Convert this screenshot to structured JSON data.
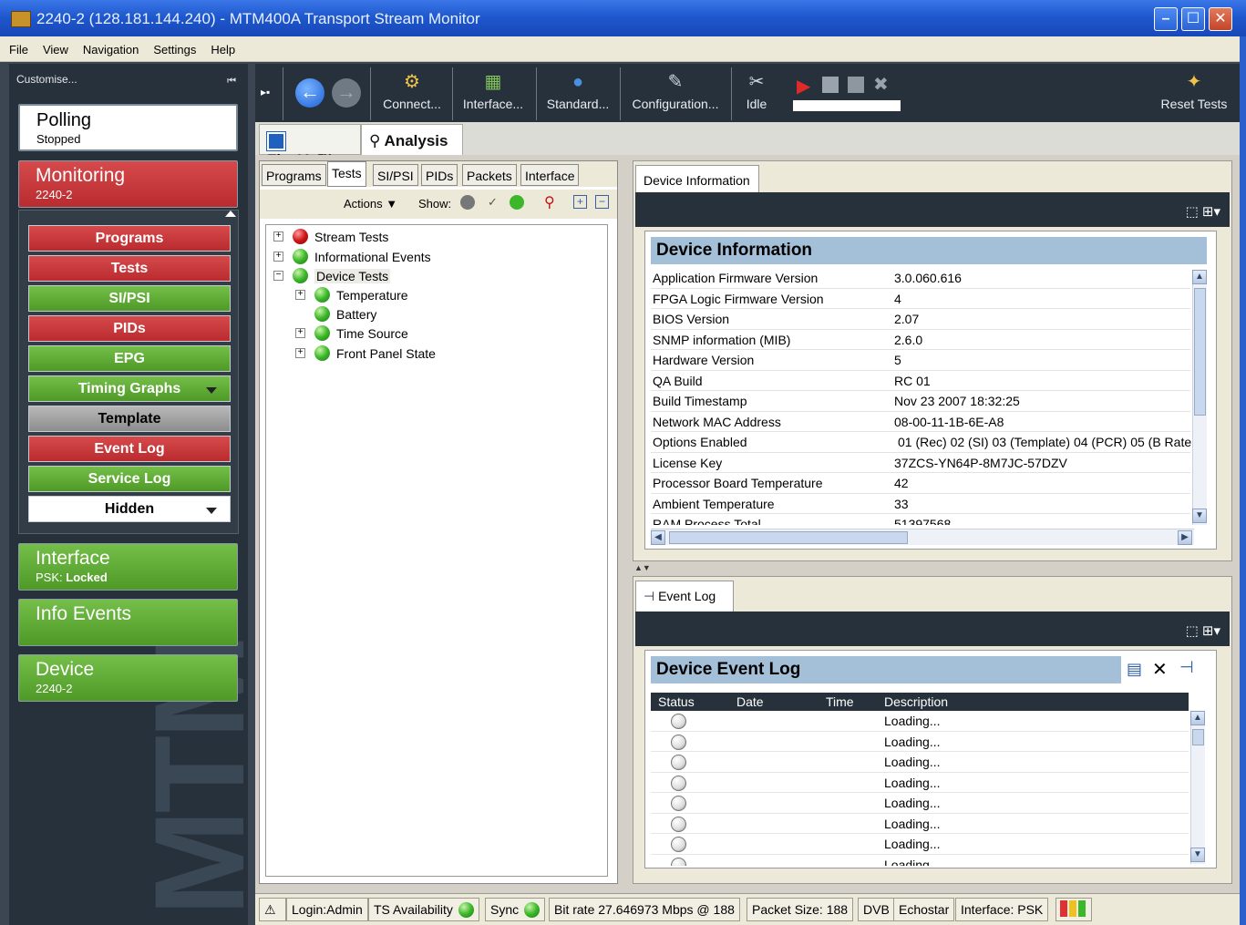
{
  "window": {
    "title": "2240-2 (128.181.144.240) - MTM400A Transport Stream Monitor"
  },
  "menu": [
    "File",
    "View",
    "Navigation",
    "Settings",
    "Help"
  ],
  "sidebar": {
    "customise_label": "Customise...",
    "polling": {
      "title": "Polling",
      "status": "Stopped"
    },
    "monitoring": {
      "title": "Monitoring",
      "sub": "2240-2"
    },
    "items": [
      {
        "label": "Programs",
        "color": "red"
      },
      {
        "label": "Tests",
        "color": "red"
      },
      {
        "label": "SI/PSI",
        "color": "green"
      },
      {
        "label": "PIDs",
        "color": "red"
      },
      {
        "label": "EPG",
        "color": "green"
      },
      {
        "label": "Timing Graphs",
        "color": "green"
      },
      {
        "label": "Template",
        "color": "gray"
      },
      {
        "label": "Event Log",
        "color": "red"
      },
      {
        "label": "Service Log",
        "color": "green"
      },
      {
        "label": "Hidden",
        "color": "white"
      }
    ],
    "interface": {
      "title": "Interface",
      "sub_prefix": "PSK: ",
      "sub_value": "Locked"
    },
    "info_events": {
      "title": "Info Events"
    },
    "device": {
      "title": "Device",
      "sub": "2240-2"
    },
    "watermark": "MTM"
  },
  "toolbar": {
    "connect": "Connect...",
    "interface": "Interface...",
    "standard": "Standard...",
    "configuration": "Configuration...",
    "idle": "Idle",
    "reset_tests": "Reset Tests"
  },
  "view_tabs": {
    "flexvu": "FlexVu™",
    "analysis": "Analysis"
  },
  "left_panel": {
    "tabs": [
      "Programs",
      "Tests",
      "SI/PSI",
      "PIDs",
      "Packets",
      "Interface"
    ],
    "actions_label": "Actions",
    "show_label": "Show:",
    "tree": [
      {
        "label": "Stream Tests",
        "status": "red",
        "level": 0,
        "expander": "+"
      },
      {
        "label": "Informational Events",
        "status": "green",
        "level": 0,
        "expander": "+"
      },
      {
        "label": "Device Tests",
        "status": "green",
        "level": 0,
        "expander": "-"
      },
      {
        "label": "Temperature",
        "status": "green",
        "level": 1,
        "expander": "+"
      },
      {
        "label": "Battery",
        "status": "green",
        "level": 1,
        "expander": ""
      },
      {
        "label": "Time Source",
        "status": "green",
        "level": 1,
        "expander": "+"
      },
      {
        "label": "Front Panel State",
        "status": "green",
        "level": 1,
        "expander": "+"
      }
    ]
  },
  "device_info": {
    "tab_label": "Device Information",
    "heading": "Device Information",
    "rows": [
      {
        "key": "Application Firmware Version",
        "value": "3.0.060.616"
      },
      {
        "key": "FPGA Logic Firmware Version",
        "value": "4"
      },
      {
        "key": "BIOS Version",
        "value": "2.07"
      },
      {
        "key": "SNMP information (MIB)",
        "value": "2.6.0"
      },
      {
        "key": "Hardware Version",
        "value": "5"
      },
      {
        "key": "QA Build",
        "value": "RC 01"
      },
      {
        "key": "Build Timestamp",
        "value": "Nov 23 2007 18:32:25"
      },
      {
        "key": "Network MAC Address",
        "value": "08-00-11-1B-6E-A8"
      },
      {
        "key": "Options Enabled",
        "value": "01 (Rec) 02 (SI) 03 (Template) 04 (PCR) 05 (B Rate"
      },
      {
        "key": "License Key",
        "value": "37ZCS-YN64P-8M7JC-57DZV"
      },
      {
        "key": "Processor Board Temperature",
        "value": "42"
      },
      {
        "key": "Ambient Temperature",
        "value": "33"
      },
      {
        "key": "RAM Process Total",
        "value": "51397568"
      }
    ]
  },
  "event_log": {
    "tab_label": "Event Log",
    "heading": "Device Event Log",
    "columns": [
      "Status",
      "Date",
      "Time",
      "Description"
    ],
    "rows": [
      {
        "description": "Loading..."
      },
      {
        "description": "Loading..."
      },
      {
        "description": "Loading..."
      },
      {
        "description": "Loading..."
      },
      {
        "description": "Loading..."
      },
      {
        "description": "Loading..."
      },
      {
        "description": "Loading..."
      },
      {
        "description": "Loading..."
      }
    ]
  },
  "statusbar": {
    "login": "Login:Admin",
    "ts_availability": "TS Availability",
    "sync": "Sync",
    "bitrate": "Bit rate  27.646973 Mbps @ 188",
    "packet_size": "Packet Size: 188",
    "dvb": "DVB",
    "network": "Echostar",
    "interface": "Interface: PSK"
  },
  "colors": {
    "green": "#5fae36",
    "red": "#c83a3c",
    "dark": "#27313b",
    "header_blue": "#a3c0d8"
  }
}
